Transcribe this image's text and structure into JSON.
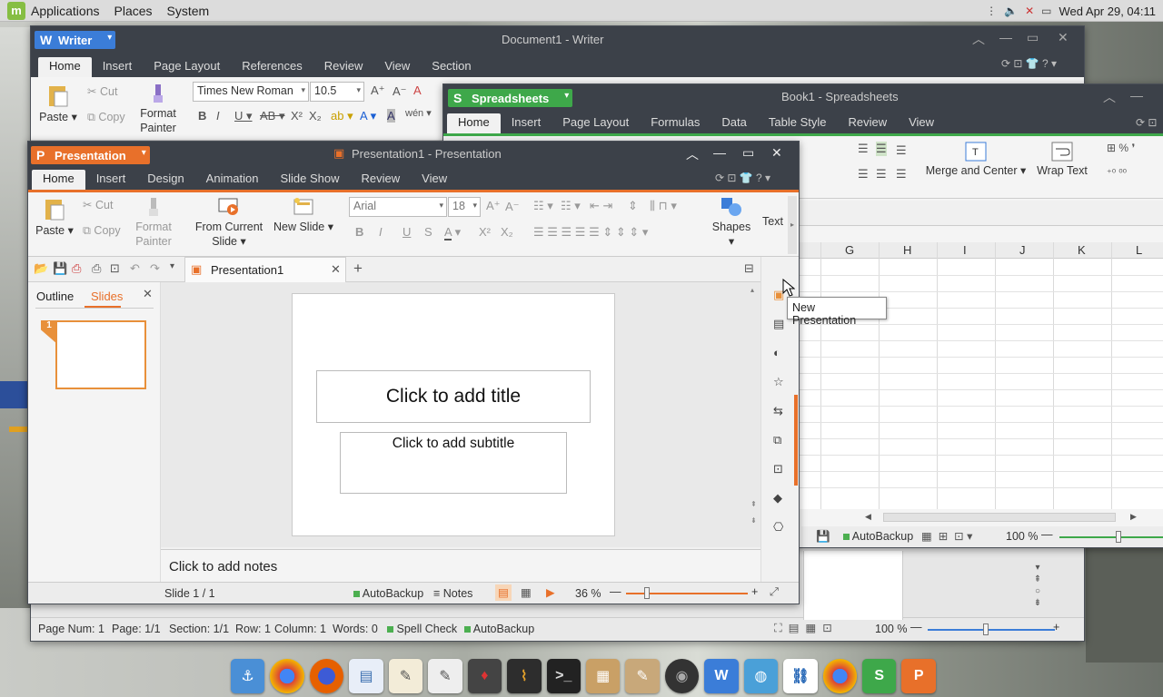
{
  "panel": {
    "menu": [
      "Applications",
      "Places",
      "System"
    ],
    "clock": "Wed Apr 29, 04:11"
  },
  "writer": {
    "app_button": "Writer",
    "title": "Document1 - Writer",
    "tabs": [
      "Home",
      "Insert",
      "Page Layout",
      "References",
      "Review",
      "View",
      "Section"
    ],
    "paste": "Paste",
    "cut": "Cut",
    "copy": "Copy",
    "format_painter": "Format Painter",
    "font": "Times New Roman",
    "size": "10.5",
    "status": {
      "page_num": "Page Num: 1",
      "page": "Page: 1/1",
      "section": "Section: 1/1",
      "row": "Row: 1",
      "column": "Column: 1",
      "words": "Words: 0",
      "spell": "Spell Check",
      "autobackup": "AutoBackup",
      "zoom": "100 %"
    }
  },
  "spreadsheets": {
    "app_button": "Spreadsheets",
    "title": "Book1 - Spreadsheets",
    "tabs": [
      "Home",
      "Insert",
      "Page Layout",
      "Formulas",
      "Data",
      "Table Style",
      "Review",
      "View"
    ],
    "merge": "Merge and Center",
    "wrap": "Wrap Text",
    "columns": [
      "G",
      "H",
      "I",
      "J",
      "K",
      "L"
    ],
    "autobackup": "AutoBackup",
    "zoom": "100 %"
  },
  "presentation": {
    "app_button": "Presentation",
    "title": "Presentation1 - Presentation",
    "tabs": [
      "Home",
      "Insert",
      "Design",
      "Animation",
      "Slide Show",
      "Review",
      "View"
    ],
    "paste": "Paste",
    "cut": "Cut",
    "copy": "Copy",
    "format_painter": "Format Painter",
    "from_current": "From Current Slide",
    "new_slide": "New Slide",
    "font": "Arial",
    "size": "18",
    "shapes": "Shapes",
    "text": "Text",
    "doc_tab": "Presentation1",
    "panel_tabs": {
      "outline": "Outline",
      "slides": "Slides"
    },
    "slide_number": "1",
    "title_placeholder": "Click to add title",
    "subtitle_placeholder": "Click to add subtitle",
    "notes_placeholder": "Click to add notes",
    "status": {
      "slide": "Slide 1 / 1",
      "autobackup": "AutoBackup",
      "notes": "Notes",
      "zoom": "36 %"
    },
    "tooltip": "New Presentation"
  },
  "dock": {
    "items": [
      "anchor",
      "chrome",
      "firefox",
      "document-viewer",
      "text-editor",
      "notepad",
      "suit",
      "system-monitor",
      "terminal",
      "archive-manager",
      "package-installer",
      "camera",
      "wps-writer",
      "shutter",
      "teamviewer",
      "chrome-2",
      "wps-spreadsheets",
      "wps-presentation"
    ]
  },
  "colors": {
    "writer": "#3b7dd8",
    "spreadsheets": "#3ea84a",
    "presentation": "#e8702a",
    "titlebar": "#3c4149"
  }
}
